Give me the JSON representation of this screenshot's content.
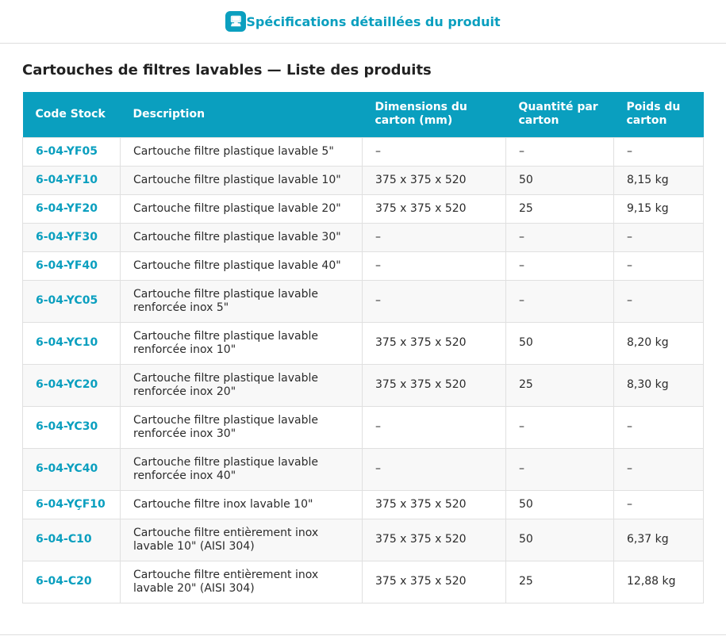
{
  "header": {
    "icon": "monitor-icon",
    "icon_glyph": "🖥",
    "tab_label": "Spécifications détaillées du produit",
    "accent_color": "#0a9fbf"
  },
  "page_title": "Cartouches de filtres lavables — Liste des produits",
  "table": {
    "columns": [
      "Code Stock",
      "Description",
      "Dimensions du carton (mm)",
      "Quantité par carton",
      "Poids du carton"
    ],
    "rows": [
      {
        "code": "6-04-YF05",
        "description": "Cartouche filtre plastique lavable 5\"",
        "dimensions": "–",
        "quantity": "–",
        "weight": "–"
      },
      {
        "code": "6-04-YF10",
        "description": "Cartouche filtre plastique lavable 10\"",
        "dimensions": "375 x 375 x 520",
        "quantity": "50",
        "weight": "8,15 kg"
      },
      {
        "code": "6-04-YF20",
        "description": "Cartouche filtre plastique lavable 20\"",
        "dimensions": "375 x 375 x 520",
        "quantity": "25",
        "weight": "9,15 kg"
      },
      {
        "code": "6-04-YF30",
        "description": "Cartouche filtre plastique lavable 30\"",
        "dimensions": "–",
        "quantity": "–",
        "weight": "–"
      },
      {
        "code": "6-04-YF40",
        "description": "Cartouche filtre plastique lavable 40\"",
        "dimensions": "–",
        "quantity": "–",
        "weight": "–"
      },
      {
        "code": "6-04-YC05",
        "description": "Cartouche filtre plastique lavable renforcée inox 5\"",
        "dimensions": "–",
        "quantity": "–",
        "weight": "–"
      },
      {
        "code": "6-04-YC10",
        "description": "Cartouche filtre plastique lavable renforcée inox 10\"",
        "dimensions": "375 x 375 x 520",
        "quantity": "50",
        "weight": "8,20 kg"
      },
      {
        "code": "6-04-YC20",
        "description": "Cartouche filtre plastique lavable renforcée inox 20\"",
        "dimensions": "375 x 375 x 520",
        "quantity": "25",
        "weight": "8,30 kg"
      },
      {
        "code": "6-04-YC30",
        "description": "Cartouche filtre plastique lavable renforcée inox 30\"",
        "dimensions": "–",
        "quantity": "–",
        "weight": "–"
      },
      {
        "code": "6-04-YC40",
        "description": "Cartouche filtre plastique lavable renforcée inox 40\"",
        "dimensions": "–",
        "quantity": "–",
        "weight": "–"
      },
      {
        "code": "6-04-YÇF10",
        "description": "Cartouche filtre inox lavable 10\"",
        "dimensions": "375 x 375 x 520",
        "quantity": "50",
        "weight": "–"
      },
      {
        "code": "6-04-C10",
        "description": "Cartouche filtre entièrement inox lavable 10\" (AISI 304)",
        "dimensions": "375 x 375 x 520",
        "quantity": "50",
        "weight": "6,37 kg"
      },
      {
        "code": "6-04-C20",
        "description": "Cartouche filtre entièrement inox lavable 20\" (AISI 304)",
        "dimensions": "375 x 375 x 520",
        "quantity": "25",
        "weight": "12,88 kg"
      }
    ]
  }
}
